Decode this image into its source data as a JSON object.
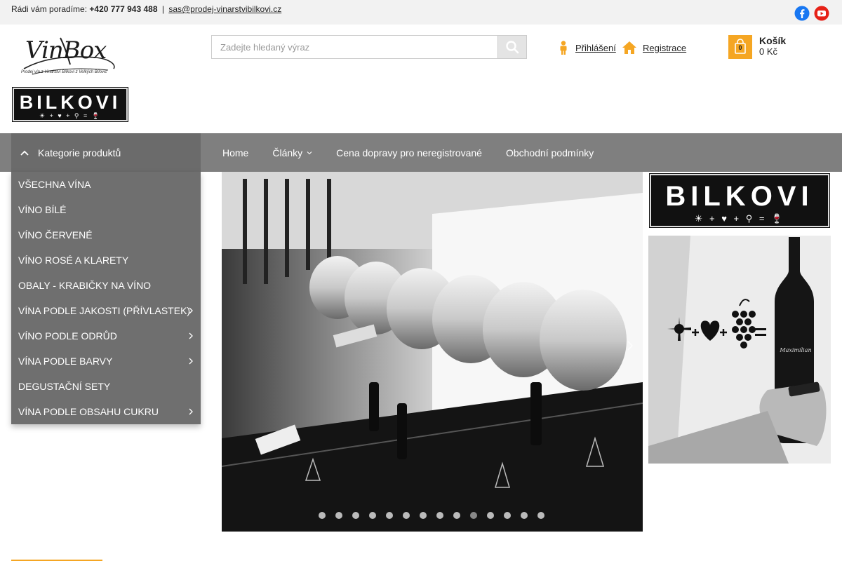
{
  "topbar": {
    "intro": "Rádi vám poradíme:",
    "phone": "+420 777 943 488",
    "separator": "|",
    "email": "sas@prodej-vinarstvibilkovi.cz"
  },
  "social": {
    "facebook_icon": "facebook-icon",
    "youtube_icon": "youtube-icon",
    "facebook_color": "#1877f2",
    "youtube_color": "#e62117"
  },
  "logo": {
    "brand": "VinBox",
    "tagline": "Prodej vín z Vinařství Bílkovi z Velkých Bílovic",
    "name": "BILKOVI",
    "symbols": "☀ + ♥ + ⚲ = 🍷"
  },
  "search": {
    "placeholder": "Zadejte hledaný výraz",
    "value": ""
  },
  "account": {
    "login_label": "Přihlášení",
    "register_label": "Registrace"
  },
  "cart": {
    "title": "Košík",
    "price": "0 Kč",
    "count": "0",
    "accent": "#f5a623"
  },
  "nav": {
    "categories_label": "Kategorie produktů",
    "items": [
      {
        "label": "Home"
      },
      {
        "label": "Články"
      },
      {
        "label": "Cena dopravy pro neregistrované"
      },
      {
        "label": "Obchodní podmínky"
      }
    ]
  },
  "categories": [
    {
      "label": "VŠECHNA VÍNA",
      "submenu": false
    },
    {
      "label": "VÍNO BÍLÉ",
      "submenu": false
    },
    {
      "label": "VÍNO ČERVENÉ",
      "submenu": false
    },
    {
      "label": "VÍNO ROSÉ A KLARETY",
      "submenu": false
    },
    {
      "label": "OBALY - KRABIČKY NA VÍNO",
      "submenu": false
    },
    {
      "label": "VÍNA PODLE JAKOSTI (PŘÍVLASTEK)",
      "submenu": true
    },
    {
      "label": "VÍNO PODLE ODRŮD",
      "submenu": true
    },
    {
      "label": "VÍNA PODLE BARVY",
      "submenu": true
    },
    {
      "label": "DEGUSTAČNÍ SETY",
      "submenu": false
    },
    {
      "label": "VÍNA PODLE OBSAHU CUKRU",
      "submenu": true
    }
  ],
  "slider": {
    "slide_count": 14,
    "active_index": 9
  },
  "banners": {
    "bilkovi_text": "BILKOVI",
    "bilkovi_symbols": "☀ + ♥ + ⚲ = 🍷",
    "bottle_label": "Maximilian"
  }
}
